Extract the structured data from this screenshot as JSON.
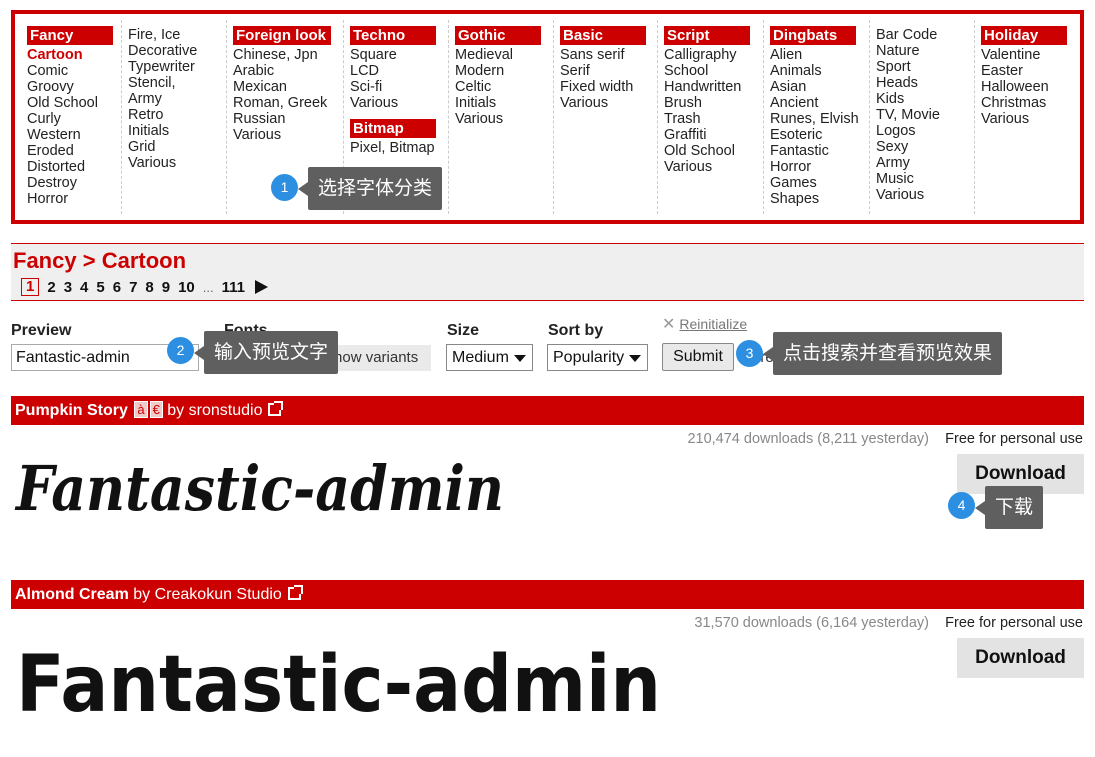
{
  "categories": [
    {
      "head": "Fancy",
      "items": [
        "Cartoon",
        "Comic",
        "Groovy",
        "Old School",
        "Curly",
        "Western",
        "Eroded",
        "Distorted",
        "Destroy",
        "Horror"
      ],
      "active": 0
    },
    {
      "head": "",
      "items": [
        "Fire, Ice",
        "Decorative",
        "Typewriter",
        "Stencil,",
        "Army",
        "Retro",
        "Initials",
        "Grid",
        "Various"
      ]
    },
    {
      "head": "Foreign look",
      "items": [
        "Chinese, Jpn",
        "Arabic",
        "Mexican",
        "Roman, Greek",
        "Russian",
        "Various"
      ]
    },
    {
      "head": "Techno",
      "items": [
        "Square",
        "LCD",
        "Sci-fi",
        "Various"
      ],
      "head2": "Bitmap",
      "items2": [
        "Pixel, Bitmap"
      ]
    },
    {
      "head": "Gothic",
      "items": [
        "Medieval",
        "Modern",
        "Celtic",
        "Initials",
        "Various"
      ]
    },
    {
      "head": "Basic",
      "items": [
        "Sans serif",
        "Serif",
        "Fixed width",
        "Various"
      ]
    },
    {
      "head": "Script",
      "items": [
        "Calligraphy",
        "School",
        "Handwritten",
        "Brush",
        "Trash",
        "Graffiti",
        "Old School",
        "Various"
      ]
    },
    {
      "head": "Dingbats",
      "items": [
        "Alien",
        "Animals",
        "Asian",
        "Ancient",
        "Runes, Elvish",
        "Esoteric",
        "Fantastic",
        "Horror",
        "Games",
        "Shapes"
      ]
    },
    {
      "head": "",
      "items": [
        "Bar Code",
        "Nature",
        "Sport",
        "Heads",
        "Kids",
        "TV, Movie",
        "Logos",
        "Sexy",
        "Army",
        "Music",
        "Various"
      ]
    },
    {
      "head": "Holiday",
      "items": [
        "Valentine",
        "Easter",
        "Halloween",
        "Christmas",
        "Various"
      ]
    }
  ],
  "annotations": [
    {
      "num": "1",
      "text": "选择字体分类"
    },
    {
      "num": "2",
      "text": "输入预览文字"
    },
    {
      "num": "3",
      "text": "点击搜索并查看预览效果"
    },
    {
      "num": "4",
      "text": "下载"
    }
  ],
  "breadcrumb": {
    "parent": "Fancy",
    "sep": ">",
    "current": "Cartoon"
  },
  "pager": {
    "pages": [
      "1",
      "2",
      "3",
      "4",
      "5",
      "6",
      "7",
      "8",
      "9",
      "10"
    ],
    "current": "1",
    "ellipsis": "...",
    "last": "111"
  },
  "form": {
    "preview_label": "Preview",
    "preview_value": "Fantastic-admin",
    "fonts_label": "Fonts",
    "show_variants": "Show variants",
    "size_label": "Size",
    "size_value": "Medium",
    "sort_label": "Sort by",
    "sort_value": "Popularity",
    "submit": "Submit",
    "reinitialize": "Reinitialize",
    "more_options": "ore"
  },
  "fonts": [
    {
      "name": "Pumpkin Story",
      "badges": [
        "à",
        "€"
      ],
      "by": "by",
      "author": "sronstudio",
      "stats": "210,474 downloads (8,211 yesterday)",
      "license": "Free for personal use",
      "download": "Download",
      "preview": "Fantastic-admin"
    },
    {
      "name": "Almond Cream",
      "badges": [],
      "by": "by",
      "author": "Creakokun Studio",
      "stats": "31,570 downloads (6,164 yesterday)",
      "license": "Free for personal use",
      "download": "Download",
      "preview": "Fantastic-admin"
    }
  ],
  "colors": {
    "accent": "#cc0000",
    "annotation_bg": "#5f5f5f",
    "annotation_num": "#2d8fe2"
  }
}
